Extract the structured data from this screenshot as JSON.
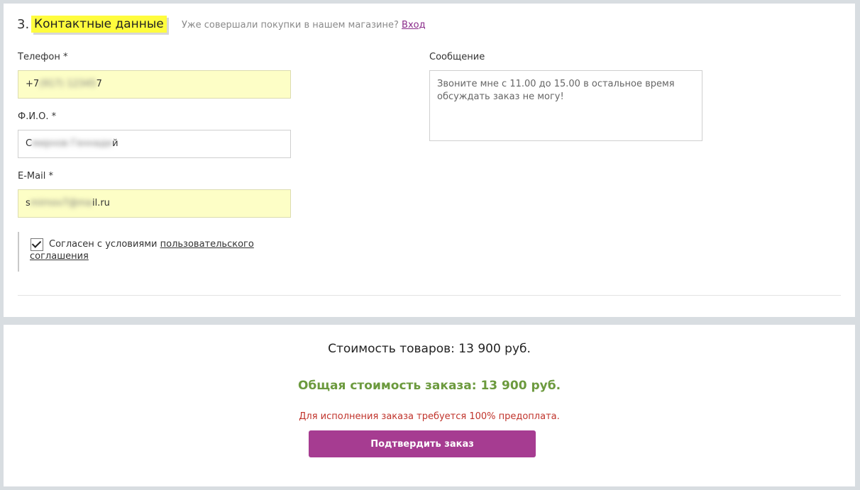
{
  "contacts": {
    "section_number": "3.",
    "section_title": "Контактные данные",
    "login_hint": "Уже совершали покупки в нашем магазине?",
    "login_link": "Вход",
    "phone": {
      "label": "Телефон *",
      "value_visible_start": "+7",
      "value_visible_end": "7"
    },
    "fio": {
      "label": "Ф.И.О. *",
      "value_visible_start": "С",
      "value_visible_end": "й"
    },
    "email": {
      "label": "E-Mail *",
      "value_visible_start": "s",
      "value_visible_end": "il.ru"
    },
    "message": {
      "label": "Сообщение",
      "value": "Звоните мне с 11.00 до 15.00 в остальное время обсуждать заказ не могу!"
    },
    "agreement": {
      "checked": true,
      "text": "Согласен с условиями",
      "link": "пользовательского соглашения"
    }
  },
  "summary": {
    "subtotal": "Стоимость товаров: 13 900 руб.",
    "total": "Общая стоимость заказа: 13 900 руб.",
    "prepayment_note": "Для исполнения заказа требуется 100% предоплата.",
    "confirm_button": "Подтвердить заказ"
  },
  "colors": {
    "highlight": "#fffc3d",
    "filled_field": "#fdfec6",
    "total_green": "#6c9a3e",
    "note_red": "#c0332b",
    "button": "#a63c91",
    "link": "#8a2b8a"
  }
}
